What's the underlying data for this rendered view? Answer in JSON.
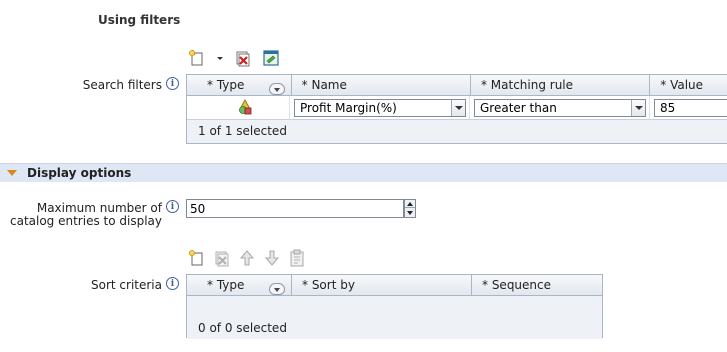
{
  "section_title": "Using filters",
  "search_filters": {
    "label": "Search filters",
    "info_icon": "i",
    "toolbar": {
      "icons": [
        "new-row-icon",
        "dropdown-arrow-icon",
        "delete-row-icon",
        "edit-row-icon"
      ]
    },
    "columns": [
      "* Type",
      "* Name",
      "* Matching rule",
      "* Value"
    ],
    "rows": [
      {
        "type_icon": "attribute-shapes-icon",
        "name": "Profit Margin(%)",
        "matching_rule": "Greater than",
        "value": "85"
      }
    ],
    "footer": "1 of 1 selected"
  },
  "display_options": {
    "title": "Display options",
    "max_entries": {
      "label_line1": "Maximum number of",
      "label_line2": "catalog entries to display",
      "value": "50"
    }
  },
  "sort_criteria": {
    "label": "Sort criteria",
    "toolbar": {
      "icons": [
        "new-row-icon",
        "delete-row-icon",
        "move-up-icon",
        "move-down-icon",
        "clipboard-icon"
      ]
    },
    "columns": [
      "* Type",
      "* Sort by",
      "* Sequence"
    ],
    "rows": [],
    "footer": "0 of 0 selected"
  },
  "colors": {
    "section_bar": "#dfe7f4",
    "grid_border": "#a9b6c6",
    "accent_triangle": "#d48a18"
  }
}
